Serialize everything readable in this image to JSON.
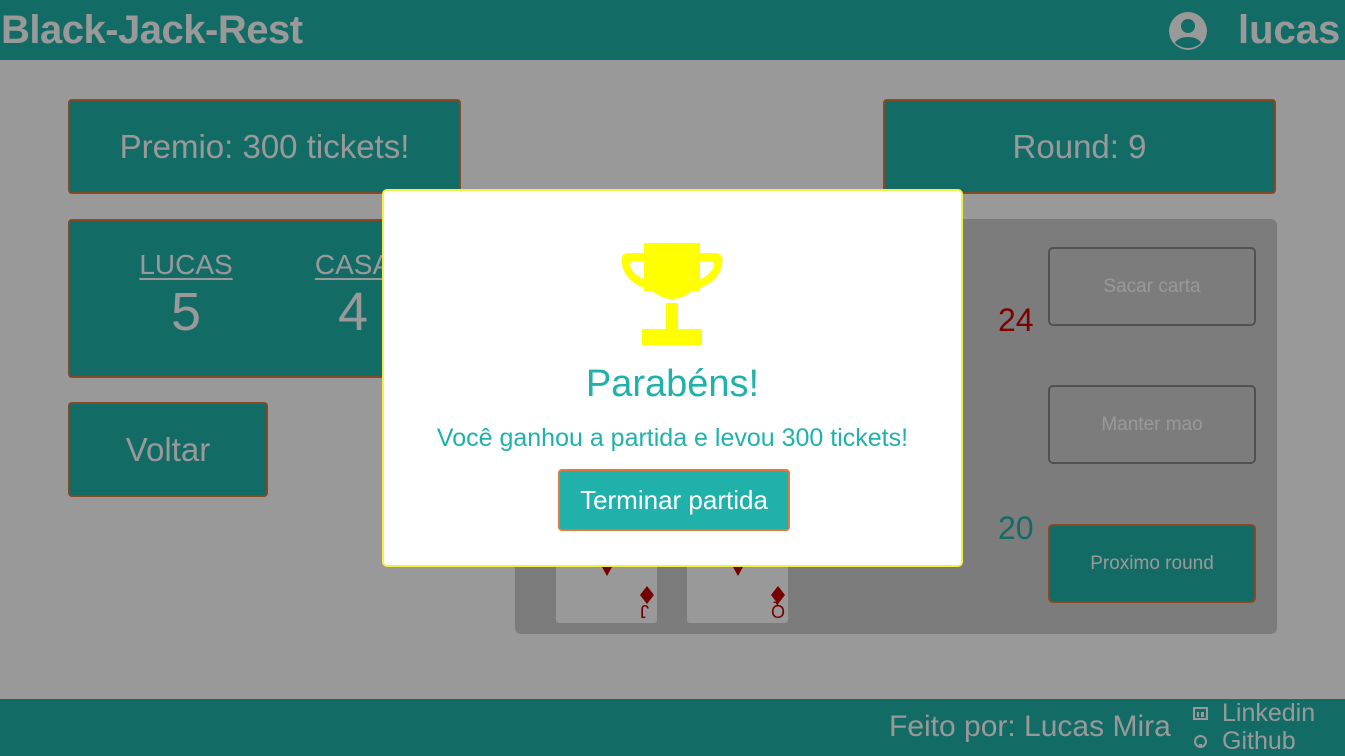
{
  "header": {
    "title": "Black-Jack-Rest",
    "user_icon": "user-circle-icon",
    "username": "lucas"
  },
  "game": {
    "prize_label": "Premio: 300 tickets!",
    "round_label": "Round: 9",
    "score": {
      "player_name": "LUCAS",
      "player_score": "5",
      "house_name": "CASA",
      "house_score": "4"
    },
    "back_label": "Voltar",
    "player_total": "24",
    "house_total": "20",
    "actions": {
      "draw_label": "Sacar carta",
      "stand_label": "Manter mao",
      "next_round_label": "Proximo round"
    },
    "cards": [
      {
        "rank": "J",
        "suit": "diamond-icon"
      },
      {
        "rank": "Q",
        "suit": "diamond-icon"
      }
    ]
  },
  "footer": {
    "credit": "Feito por: Lucas Mira",
    "linkedin_label": "Linkedin",
    "github_label": "Github"
  },
  "modal": {
    "icon": "trophy-icon",
    "title": "Parabéns!",
    "message": "Você ganhou a partida e levou 300 tickets!",
    "button_label": "Terminar partida"
  },
  "colors": {
    "primary": "#20b2aa",
    "accent_border": "#e07a3f",
    "trophy": "#ffff00",
    "loss_red": "#d40000",
    "modal_border": "#f2ee4a"
  }
}
